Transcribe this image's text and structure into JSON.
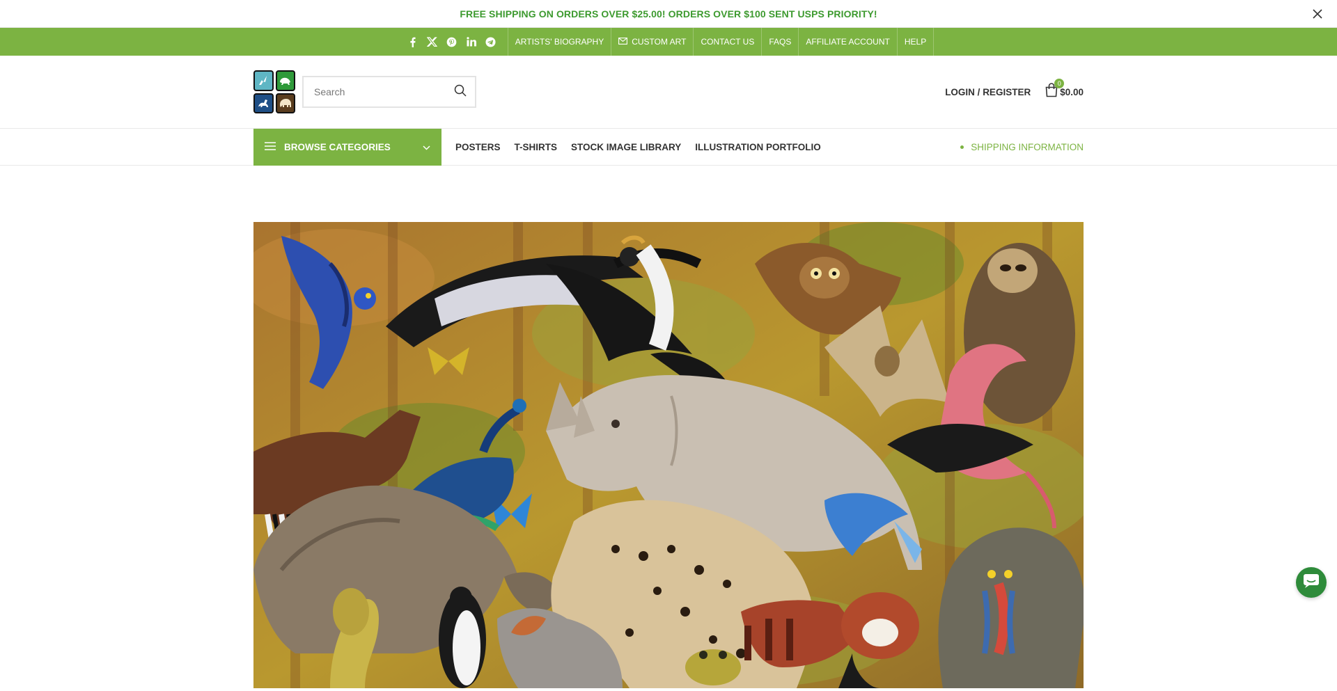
{
  "promo": {
    "text": "FREE SHIPPING ON ORDERS OVER $25.00! ORDERS OVER $100 SENT USPS PRIORITY!",
    "close_icon": "close-icon"
  },
  "topbar": {
    "social": [
      "facebook-icon",
      "x-icon",
      "pinterest-icon",
      "linkedin-icon",
      "telegram-icon"
    ],
    "links": [
      {
        "label": "ARTISTS' BIOGRAPHY"
      },
      {
        "label": "CUSTOM ART",
        "icon": "envelope-icon"
      },
      {
        "label": "CONTACT US"
      },
      {
        "label": "FAQS"
      },
      {
        "label": "AFFILIATE ACCOUNT"
      },
      {
        "label": "HELP"
      }
    ]
  },
  "header": {
    "search_placeholder": "Search",
    "login_label": "LOGIN / REGISTER",
    "cart_count": "0",
    "cart_total": "$0.00"
  },
  "mainnav": {
    "browse_label": "BROWSE CATEGORIES",
    "links": [
      "POSTERS",
      "T-SHIRTS",
      "STOCK IMAGE LIBRARY",
      "ILLUSTRATION PORTFOLIO"
    ],
    "shipping_label": "SHIPPING INFORMATION"
  },
  "colors": {
    "brand_green": "#7cb342",
    "promo_green": "#3d9a2f",
    "chat_green": "#2e8b3a"
  }
}
